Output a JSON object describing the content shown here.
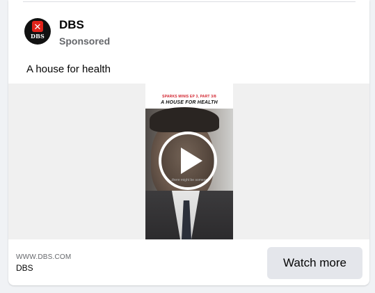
{
  "post": {
    "page_name": "DBS",
    "sponsored_label": "Sponsored",
    "avatar": {
      "mark": "✕",
      "brand_text": "DBS",
      "accent_color": "#e2231a"
    },
    "text": "A house for health"
  },
  "video": {
    "banner_kicker": "SPARKS MINIS EP 3, PART 3/8",
    "banner_title": "A HOUSE FOR HEALTH",
    "subtitle": "...there might be someone",
    "play_icon": "play-icon"
  },
  "footer": {
    "domain": "WWW.DBS.COM",
    "title": "DBS",
    "cta_label": "Watch more"
  }
}
